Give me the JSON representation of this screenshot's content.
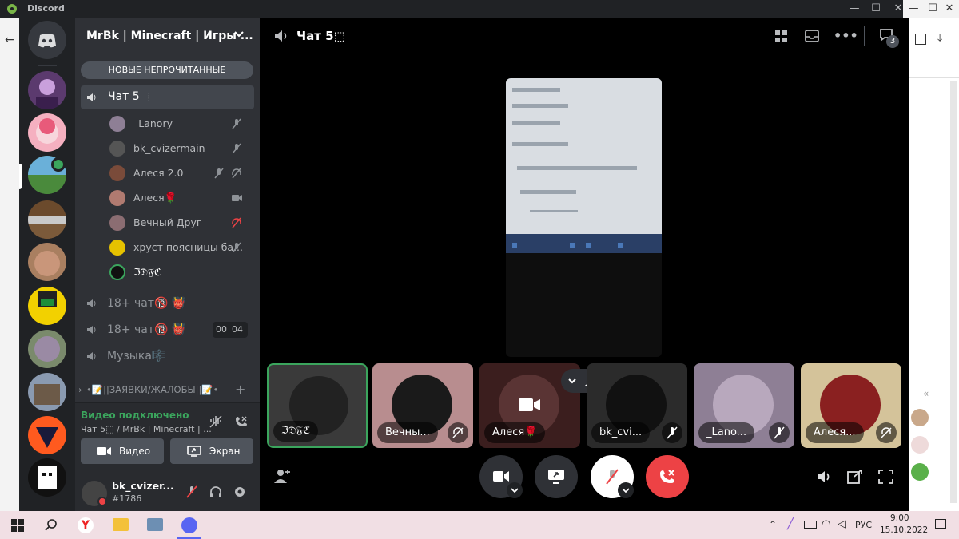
{
  "window": {
    "app_name": "Discord"
  },
  "server": {
    "name": "MrBk | Minecraft | Игры ..."
  },
  "unread_pill": "НОВЫЕ НЕПРОЧИТАННЫЕ",
  "voice_channels": [
    {
      "name": "Чат 5⬚",
      "active": true
    },
    {
      "name": "18+ чат🔞 👹"
    },
    {
      "name": "18+ чат🔞 👹",
      "timer": [
        "00",
        "04"
      ]
    },
    {
      "name": "Музыка🎼"
    }
  ],
  "members": [
    {
      "name": "_Lanory_",
      "icon": "mic-muted-icon",
      "color": "#8e7f95"
    },
    {
      "name": "bk_cvizermain",
      "icon": "mic-muted-icon",
      "color": "#555"
    },
    {
      "name": "Алеся 2.0",
      "icon": "mic-muted-icon",
      "icon2": "deafened-icon",
      "color": "#7a4b3a"
    },
    {
      "name": "Алеся🌹",
      "icon": "camera-icon",
      "color": "#b07a70"
    },
    {
      "name": "Вечный Друг",
      "icon": "deafened-icon-red",
      "color": "#8b6d72"
    },
    {
      "name": "хруст поясницы ба...",
      "icon": "mic-muted-icon",
      "color": "#e6c200"
    },
    {
      "name": "ℑ𝔇𝔉ℭ",
      "speaking": true,
      "color": "#111"
    }
  ],
  "category": {
    "label": "•📝||ЗАЯВКИ/ЖАЛОБЫ||📝•"
  },
  "voice_panel": {
    "status": "Видео подключено",
    "channel": "Чат 5⬚ / MrBk | Minecraft | ...",
    "video_btn": "Видео",
    "screen_btn": "Экран"
  },
  "user": {
    "name": "bk_cvizer...",
    "tag": "#1786"
  },
  "stage": {
    "channel_title": "Чат 5⬚",
    "inbox_count": "3",
    "tiles": [
      {
        "label": "ℑ𝔇𝔉ℭ",
        "speaking": true,
        "bg": "#3a3a3a"
      },
      {
        "label": "Вечны...",
        "bg": "#b88d8f"
      },
      {
        "label": "Алеся🌹",
        "bg": "#3b1e1e",
        "camera": true
      },
      {
        "label": "bk_cvi...",
        "bg": "#2b2b2b"
      },
      {
        "label": "_Lano...",
        "bg": "#8e7f95"
      },
      {
        "label": "Алеся...",
        "bg": "#d4c39a"
      }
    ]
  },
  "taskbar": {
    "lang": "РУС",
    "time": "9:00",
    "date": "15.10.2022"
  },
  "colors": {
    "green": "#3ba55d",
    "red": "#ed4245",
    "blurple": "#5865f2",
    "active_bg": "#42464d"
  }
}
